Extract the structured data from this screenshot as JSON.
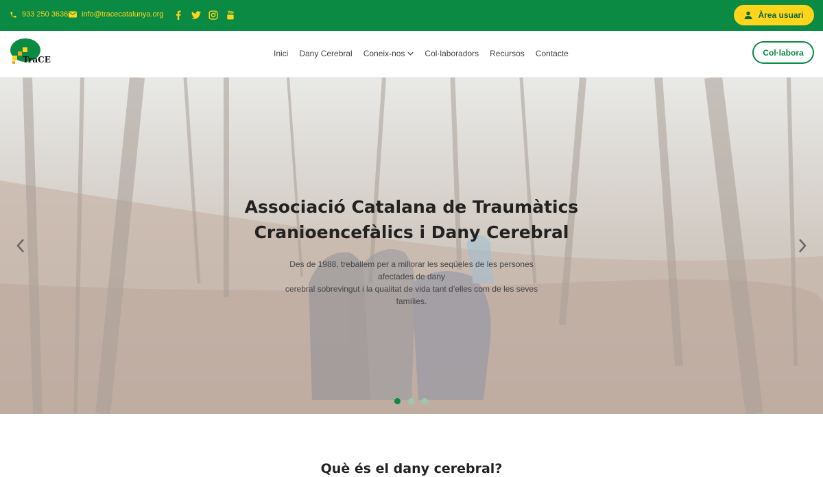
{
  "topbar": {
    "phone": "933 250 3636",
    "email": "info@tracecatalunya.org",
    "social": [
      "facebook-icon",
      "twitter-icon",
      "instagram-icon",
      "youtube-icon"
    ],
    "user_area_label": "Àrea usuari"
  },
  "header": {
    "logo_text": "TraCE",
    "nav": {
      "items": [
        {
          "label": "Inici"
        },
        {
          "label": "Dany Cerebral"
        },
        {
          "label": "Coneix-nos"
        },
        {
          "label": "Col·laboradors"
        },
        {
          "label": "Recursos"
        },
        {
          "label": "Contacte"
        }
      ]
    },
    "cta_label": "Col·labora"
  },
  "hero": {
    "title_line1": "Associació Catalana de Traumàtics",
    "title_line2": "Cranioencefàlics i Dany Cerebral",
    "subtitle_line1": "Des de 1988, treballem per a millorar les seqüeles de les persones afectades de dany",
    "subtitle_line2": "cerebral sobrevingut i la qualitat de vida tant d’elles com de les seves famílies.",
    "slides_count": 3,
    "active_slide": 1
  },
  "section": {
    "title": "Què és el dany cerebral?"
  },
  "colors": {
    "brand_green": "#0a8a43",
    "brand_yellow": "#ffd51c"
  }
}
